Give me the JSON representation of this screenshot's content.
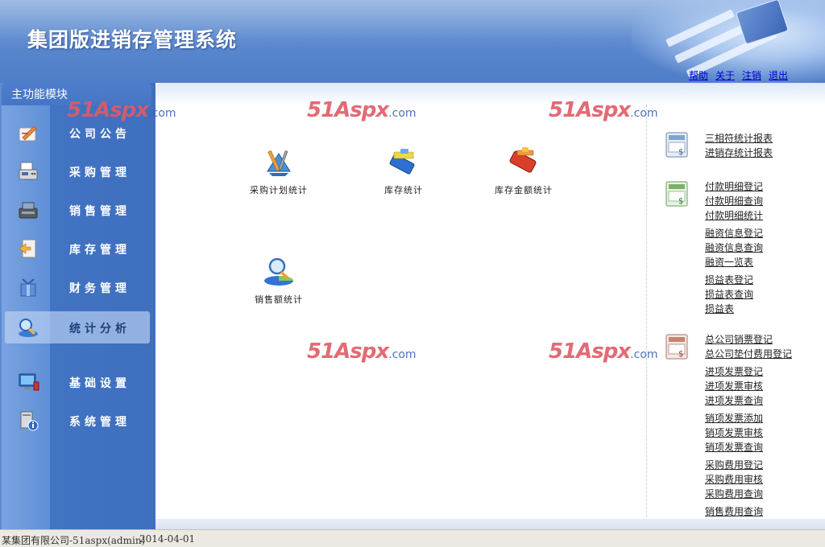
{
  "header": {
    "title": "集团版进销存管理系统",
    "links": [
      "帮助",
      "关于",
      "注销",
      "退出"
    ]
  },
  "sidebar": {
    "title": "主功能模块",
    "items": [
      {
        "label": "公司公告",
        "icon": "notice-pen-icon"
      },
      {
        "label": "采购管理",
        "icon": "fax-machine-icon"
      },
      {
        "label": "销售管理",
        "icon": "cash-register-icon"
      },
      {
        "label": "库存管理",
        "icon": "warehouse-door-icon"
      },
      {
        "label": "财务管理",
        "icon": "finance-gift-icon"
      },
      {
        "label": "统计分析",
        "icon": "magnifier-chart-icon",
        "active": true
      },
      {
        "label": "基础设置",
        "icon": "computer-monitor-icon"
      },
      {
        "label": "系统管理",
        "icon": "system-info-icon"
      }
    ]
  },
  "watermark": {
    "text": "51Aspx",
    "suffix": ".com"
  },
  "features": [
    {
      "label": "采购计划统计",
      "icon": "tools-blueprint-icon"
    },
    {
      "label": "库存统计",
      "icon": "blue-folder-icon"
    },
    {
      "label": "库存金额统计",
      "icon": "red-book-icon"
    },
    {
      "label": "销售额统计",
      "icon": "magnifier-pie-icon"
    }
  ],
  "link_groups": [
    {
      "icon": "report-calculator-icon",
      "links": [
        "三相符统计报表",
        "进销存统计报表"
      ]
    },
    {
      "icon": "green-ledger-icon",
      "links": [
        "付款明细登记",
        "付款明细查询",
        "付款明细统计",
        "融资信息登记",
        "融资信息查询",
        "融资一览表",
        "损益表登记",
        "损益表查询",
        "损益表"
      ]
    },
    {
      "icon": "red-ledger-icon",
      "links": [
        "总公司销票登记",
        "总公司垫付费用登记",
        "进项发票登记",
        "进项发票审核",
        "进项发票查询",
        "销项发票添加",
        "销项发票审核",
        "销项发票查询",
        "采购费用登记",
        "采购费用审核",
        "采购费用查询",
        "销售费用查询"
      ]
    }
  ],
  "statusbar": {
    "company": "某集团有限公司-51aspx(admin)",
    "date": "2014-04-01"
  }
}
